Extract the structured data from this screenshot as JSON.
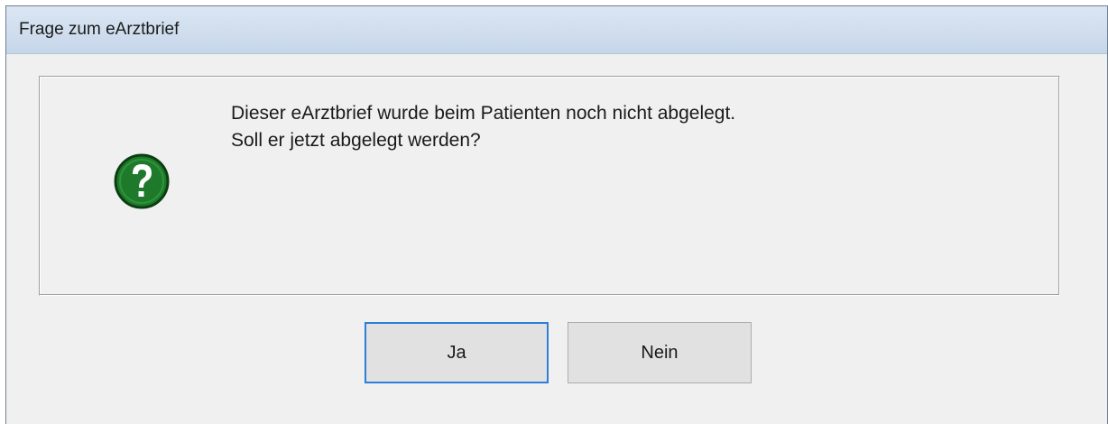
{
  "window": {
    "title": "Frage zum eArztbrief"
  },
  "message": {
    "line1": "Dieser eArztbrief wurde beim Patienten noch nicht abgelegt.",
    "line2": "Soll er jetzt abgelegt werden?",
    "icon": "question-icon"
  },
  "buttons": {
    "yes_label": "Ja",
    "no_label": "Nein",
    "default": "yes"
  },
  "colors": {
    "icon_green": "#1e7a2a",
    "focus_border": "#2d7fd8",
    "dialog_background": "#f0f0f0"
  }
}
